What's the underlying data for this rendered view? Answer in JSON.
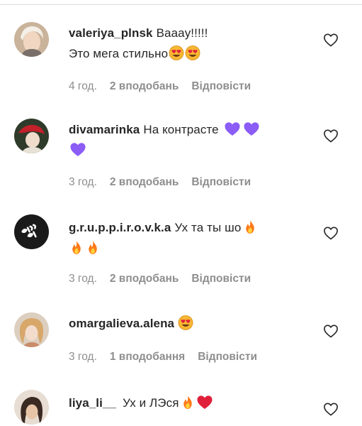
{
  "comments": [
    {
      "username": "valeriya_plnsk",
      "text_line1": "Вaaay!!!!!",
      "text_line2": "Это мега стильно",
      "emojis": [
        "heart-eyes-icon",
        "heart-eyes-icon"
      ],
      "time": "4 год.",
      "likes": "2 вподобань",
      "reply": "Відповісти"
    },
    {
      "username": "divamarinka",
      "text_line1": "На контрасте",
      "emojis": [
        "purple-heart-icon",
        "purple-heart-icon",
        "purple-heart-icon"
      ],
      "time": "3 год.",
      "likes": "2 вподобань",
      "reply": "Відповісти"
    },
    {
      "username": "g.r.u.p.p.i.r.o.v.k.a",
      "text_line1": "Ух та ты шо",
      "emojis": [
        "fire-icon",
        "fire-icon",
        "fire-icon"
      ],
      "time": "3 год.",
      "likes": "2 вподобань",
      "reply": "Відповісти"
    },
    {
      "username": "omargalieva.alena",
      "text_line1": "",
      "emojis": [
        "heart-eyes-icon"
      ],
      "time": "3 год.",
      "likes": "1 вподобання",
      "reply": "Відповісти"
    },
    {
      "username": "liya_li__",
      "text_line1": "Ух и ЛЭся",
      "emojis": [
        "fire-icon",
        "red-heart-icon"
      ]
    }
  ],
  "colors": {
    "text": "#262626",
    "meta": "#8e8e8e",
    "purple_heart": "#8b5cf6",
    "red_heart": "#e0203a",
    "fire": "#ff7a1a"
  },
  "icons": {
    "like": "heart-outline-icon"
  }
}
